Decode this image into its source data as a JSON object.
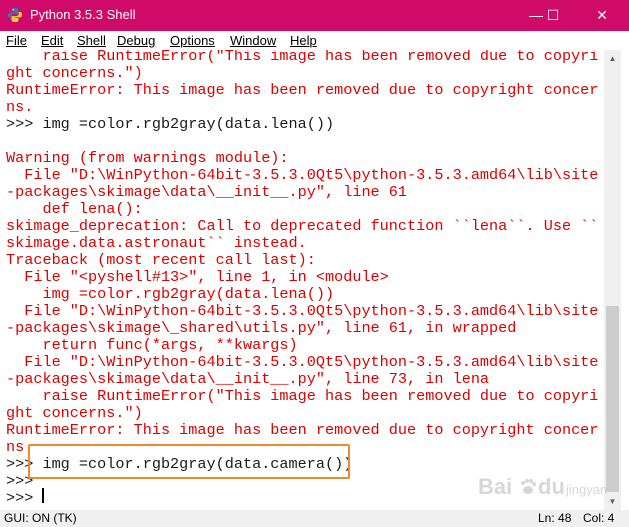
{
  "window": {
    "title": "Python 3.5.3 Shell",
    "minimize_glyph": "—",
    "maximize_glyph": "☐",
    "close_glyph": "✕"
  },
  "menu": {
    "items": [
      "File",
      "Edit",
      "Shell",
      "Debug",
      "Options",
      "Window",
      "Help"
    ]
  },
  "shell": {
    "lines": [
      {
        "text": "    raise RuntimeError(\"This image has been removed due to copyri",
        "kind": "error"
      },
      {
        "text": "ght concerns.\")",
        "kind": "error"
      },
      {
        "text": "RuntimeError: This image has been removed due to copyright concer",
        "kind": "error"
      },
      {
        "text": "ns.",
        "kind": "error"
      },
      {
        "text": ">>> img =color.rgb2gray(data.lena())",
        "kind": "prompt"
      },
      {
        "text": "",
        "kind": "prompt"
      },
      {
        "text": "Warning (from warnings module):",
        "kind": "error"
      },
      {
        "text": "  File \"D:\\WinPython-64bit-3.5.3.0Qt5\\python-3.5.3.amd64\\lib\\site",
        "kind": "error"
      },
      {
        "text": "-packages\\skimage\\data\\__init__.py\", line 61",
        "kind": "error"
      },
      {
        "text": "    def lena():",
        "kind": "error"
      },
      {
        "text": "skimage_deprecation: Call to deprecated function ``lena``. Use ``",
        "kind": "error"
      },
      {
        "text": "skimage.data.astronaut`` instead.",
        "kind": "error"
      },
      {
        "text": "Traceback (most recent call last):",
        "kind": "error"
      },
      {
        "text": "  File \"<pyshell#13>\", line 1, in <module>",
        "kind": "error"
      },
      {
        "text": "    img =color.rgb2gray(data.lena())",
        "kind": "error"
      },
      {
        "text": "  File \"D:\\WinPython-64bit-3.5.3.0Qt5\\python-3.5.3.amd64\\lib\\site",
        "kind": "error"
      },
      {
        "text": "-packages\\skimage\\_shared\\utils.py\", line 61, in wrapped",
        "kind": "error"
      },
      {
        "text": "    return func(*args, **kwargs)",
        "kind": "error"
      },
      {
        "text": "  File \"D:\\WinPython-64bit-3.5.3.0Qt5\\python-3.5.3.amd64\\lib\\site",
        "kind": "error"
      },
      {
        "text": "-packages\\skimage\\data\\__init__.py\", line 73, in lena",
        "kind": "error"
      },
      {
        "text": "    raise RuntimeError(\"This image has been removed due to copyri",
        "kind": "error"
      },
      {
        "text": "ght concerns.\")",
        "kind": "error"
      },
      {
        "text": "RuntimeError: This image has been removed due to copyright concer",
        "kind": "error"
      },
      {
        "text": "ns.",
        "kind": "error"
      },
      {
        "text": ">>> img =color.rgb2gray(data.camera())",
        "kind": "prompt"
      },
      {
        "text": ">>>",
        "kind": "prompt"
      },
      {
        "text": ">>> ",
        "kind": "prompt"
      }
    ]
  },
  "status": {
    "left": "GUI: ON (TK)",
    "line": "Ln: 48",
    "col": "Col: 4"
  },
  "watermark": {
    "brand": "Bai",
    "brand_suffix": "du",
    "subtitle": "jingyan"
  },
  "colors": {
    "titlebar": "#cf0a69",
    "error_text": "#dd0000",
    "prompt_text": "#1a1a1a",
    "highlight": "#f0882c"
  }
}
